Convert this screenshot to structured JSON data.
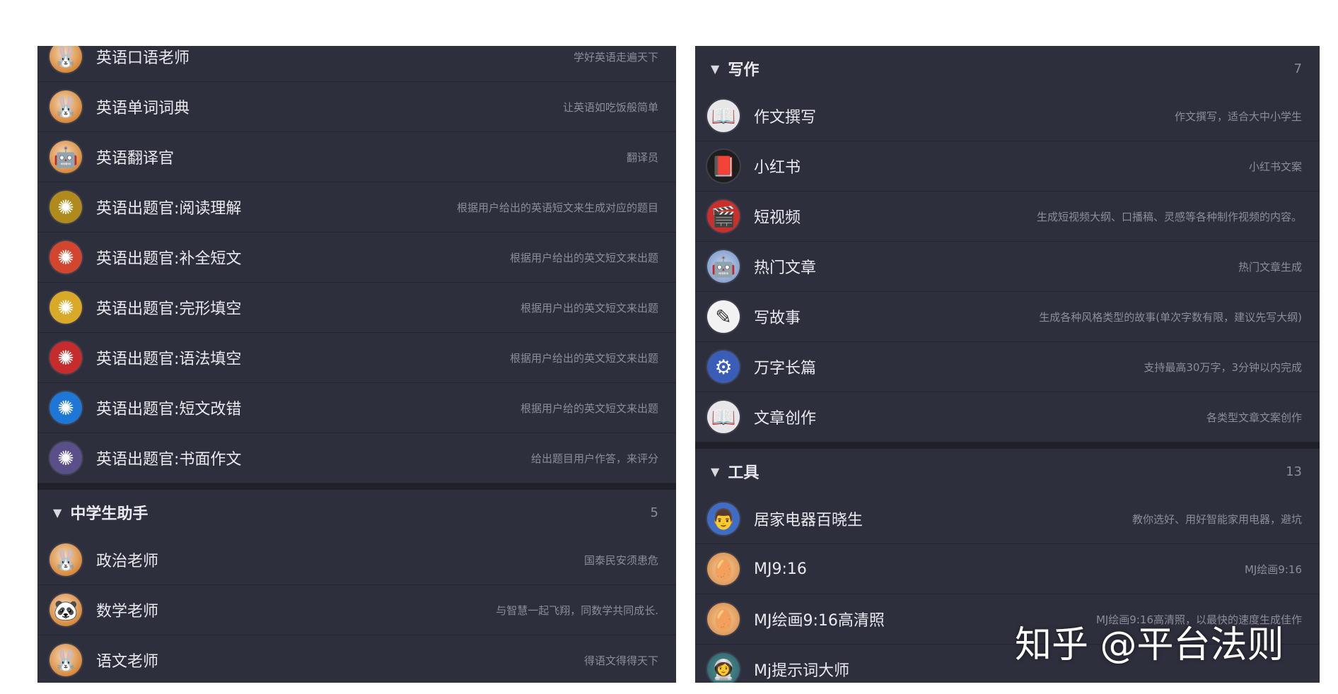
{
  "left": {
    "top_items": [
      {
        "name": "英语口语老师",
        "desc": "学好英语走遍天下",
        "icon": "rabbit-avatar-icon",
        "color": "rabbit"
      },
      {
        "name": "英语单词词典",
        "desc": "让英语如吃饭般简单",
        "icon": "rabbit-avatar-icon",
        "color": "rabbit"
      },
      {
        "name": "英语翻译官",
        "desc": "翻译员",
        "icon": "robot-avatar-icon",
        "color": "rabbit"
      },
      {
        "name": "英语出题官:阅读理解",
        "desc": "根据用户给出的英语短文来生成对应的题目",
        "icon": "openai-logo-icon",
        "color": "gold"
      },
      {
        "name": "英语出题官:补全短文",
        "desc": "根据用户给出的英文短文来出题",
        "icon": "openai-logo-icon",
        "color": "red"
      },
      {
        "name": "英语出题官:完形填空",
        "desc": "根据用户出的英文短文来出题",
        "icon": "openai-logo-icon",
        "color": "yellow"
      },
      {
        "name": "英语出题官:语法填空",
        "desc": "根据用户给出的英文短文来出题",
        "icon": "openai-logo-icon",
        "color": "crimson"
      },
      {
        "name": "英语出题官:短文改错",
        "desc": "根据用户给的英文短文来出题",
        "icon": "openai-logo-icon",
        "color": "blue"
      },
      {
        "name": "英语出题官:书面作文",
        "desc": "给出题目用户作答，来评分",
        "icon": "openai-logo-icon",
        "color": "purple"
      }
    ],
    "section": {
      "title": "中学生助手",
      "count": "5"
    },
    "section_items": [
      {
        "name": "政治老师",
        "desc": "国泰民安须患危",
        "icon": "rabbit-avatar-icon",
        "color": "rabbit"
      },
      {
        "name": "数学老师",
        "desc": "与智慧一起飞翔，同数学共同成长.",
        "icon": "panda-avatar-icon",
        "color": "rabbit"
      },
      {
        "name": "语文老师",
        "desc": "得语文得得天下",
        "icon": "rabbit-avatar-icon",
        "color": "rabbit"
      }
    ]
  },
  "right": {
    "section1": {
      "title": "写作",
      "count": "7"
    },
    "section1_items": [
      {
        "name": "作文撰写",
        "desc": "作文撰写，适合大中小学生",
        "icon": "open-book-icon",
        "color": "book"
      },
      {
        "name": "小红书",
        "desc": "小红书文案",
        "icon": "red-book-icon",
        "color": "redbook"
      },
      {
        "name": "短视频",
        "desc": "生成短视频大纲、口播稿、灵感等各种制作视频的内容。",
        "icon": "film-clapper-icon",
        "color": "film"
      },
      {
        "name": "热门文章",
        "desc": "热门文章生成",
        "icon": "robot-avatar-icon",
        "color": "robot"
      },
      {
        "name": "写故事",
        "desc": "生成各种风格类型的故事(单次字数有限，建议先写大纲)",
        "icon": "story-badge-icon",
        "color": "white"
      },
      {
        "name": "万字长篇",
        "desc": "支持最高30万字，3分钟以内完成",
        "icon": "machine-icon",
        "color": "machine"
      },
      {
        "name": "文章创作",
        "desc": "各类型文章文案创作",
        "icon": "open-book-icon",
        "color": "book"
      }
    ],
    "section2": {
      "title": "工具",
      "count": "13"
    },
    "section2_items": [
      {
        "name": "居家电器百晓生",
        "desc": "教你选好、用好智能家用电器，避坑",
        "icon": "man-avatar-icon",
        "color": "man"
      },
      {
        "name": "MJ9:16",
        "desc": "MJ绘画9:16",
        "icon": "egg-avatar-icon",
        "color": "egg"
      },
      {
        "name": "MJ绘画9:16高清照",
        "desc": "MJ绘画9:16高清照，以最快的速度生成佳作",
        "icon": "egg-avatar-icon",
        "color": "egg"
      },
      {
        "name": "Mj提示词大师",
        "desc": "",
        "icon": "astronaut-avatar-icon",
        "color": "astro"
      }
    ]
  },
  "watermark": "知乎 @平台法则",
  "glyphs": {
    "rabbit-avatar-icon": "🐰",
    "robot-avatar-icon": "🤖",
    "panda-avatar-icon": "🐼",
    "openai-logo-icon": "✺",
    "open-book-icon": "📖",
    "red-book-icon": "📕",
    "film-clapper-icon": "🎬",
    "story-badge-icon": "✎",
    "machine-icon": "⚙",
    "man-avatar-icon": "👨",
    "egg-avatar-icon": "🥚",
    "astronaut-avatar-icon": "👩‍🚀"
  }
}
